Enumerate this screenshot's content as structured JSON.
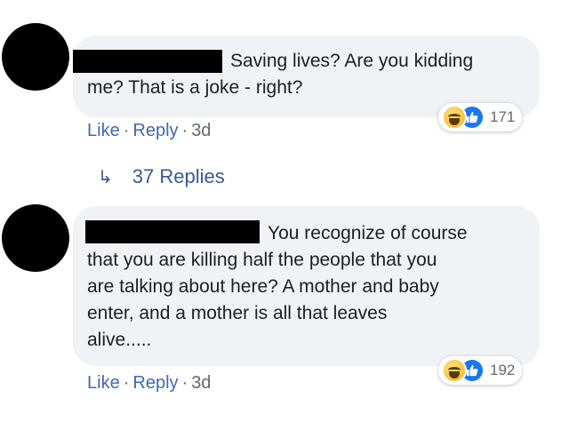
{
  "comments": [
    {
      "text": "Saving lives? Are you kidding me? That is a joke - right?",
      "text_lines": [
        "Saving lives? Are you kidding",
        "me? That is a joke - right?"
      ],
      "actions": {
        "like": "Like",
        "reply": "Reply",
        "time": "3d",
        "sep": "·"
      },
      "reaction_count": "171",
      "reaction_icons": [
        "haha-icon",
        "like-icon"
      ]
    },
    {
      "text": "You recognize of course that you are killing half the people that you are talking about here? A mother and baby enter, and a mother is all that leaves alive.....",
      "text_lines": [
        "You recognize of course",
        "that you are killing half the people that you",
        "are talking about here? A mother and baby",
        "enter, and a mother is all that leaves",
        "alive....."
      ],
      "actions": {
        "like": "Like",
        "reply": "Reply",
        "time": "3d",
        "sep": "·"
      },
      "reaction_count": "192",
      "reaction_icons": [
        "haha-icon",
        "like-icon"
      ]
    }
  ],
  "replies_link": {
    "icon": "↳",
    "label": "37 Replies"
  },
  "colors": {
    "bubble": "#f0f2f5",
    "link": "#4267b2",
    "meta": "#65676b",
    "like_blue": "#1877f2"
  }
}
